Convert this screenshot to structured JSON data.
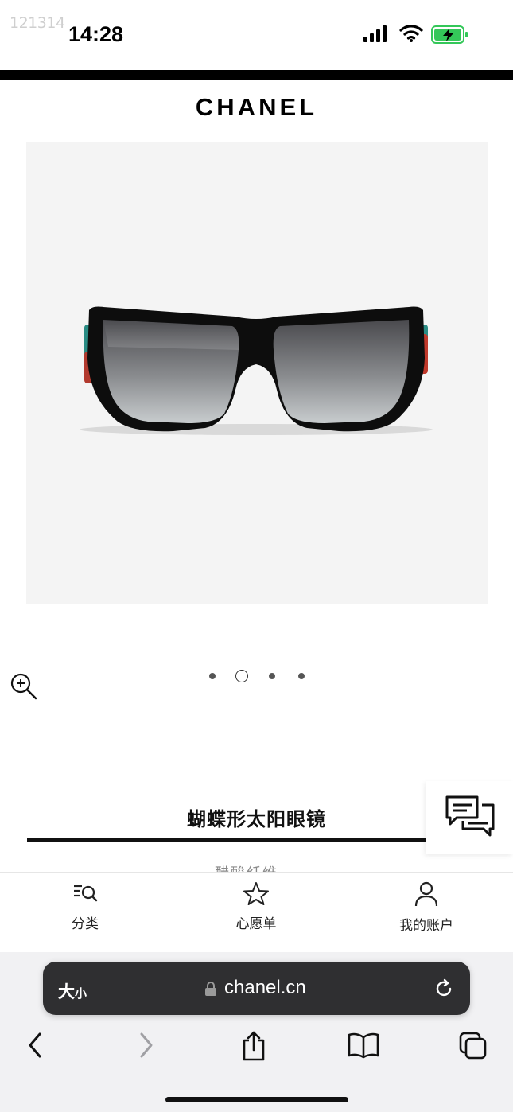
{
  "status_bar": {
    "watermark": "121314",
    "time": "14:28",
    "icons": [
      "cellular-signal-icon",
      "wifi-icon",
      "battery-charging-icon"
    ],
    "battery_color": "#34c759"
  },
  "header": {
    "logo": "CHANEL"
  },
  "product": {
    "image_alt": "sunglasses",
    "carousel": {
      "count": 4,
      "active_index": 1
    },
    "title": "蝴蝶形太阳眼镜",
    "partial_subtitle": "醋酸纤维"
  },
  "bottom_nav": {
    "items": [
      {
        "label": "分类",
        "icon": "category-search-icon"
      },
      {
        "label": "心愿单",
        "icon": "star-icon"
      },
      {
        "label": "我的账户",
        "icon": "user-icon"
      }
    ]
  },
  "browser": {
    "text_size_big": "大",
    "text_size_small": "小",
    "url": "chanel.cn",
    "toolbar": [
      "back-icon",
      "forward-icon",
      "share-icon",
      "bookmarks-icon",
      "tabs-icon"
    ]
  },
  "colors": {
    "brand": "#000000",
    "url_bar": "#2f2f31",
    "panel_bg": "#f4f4f4"
  }
}
